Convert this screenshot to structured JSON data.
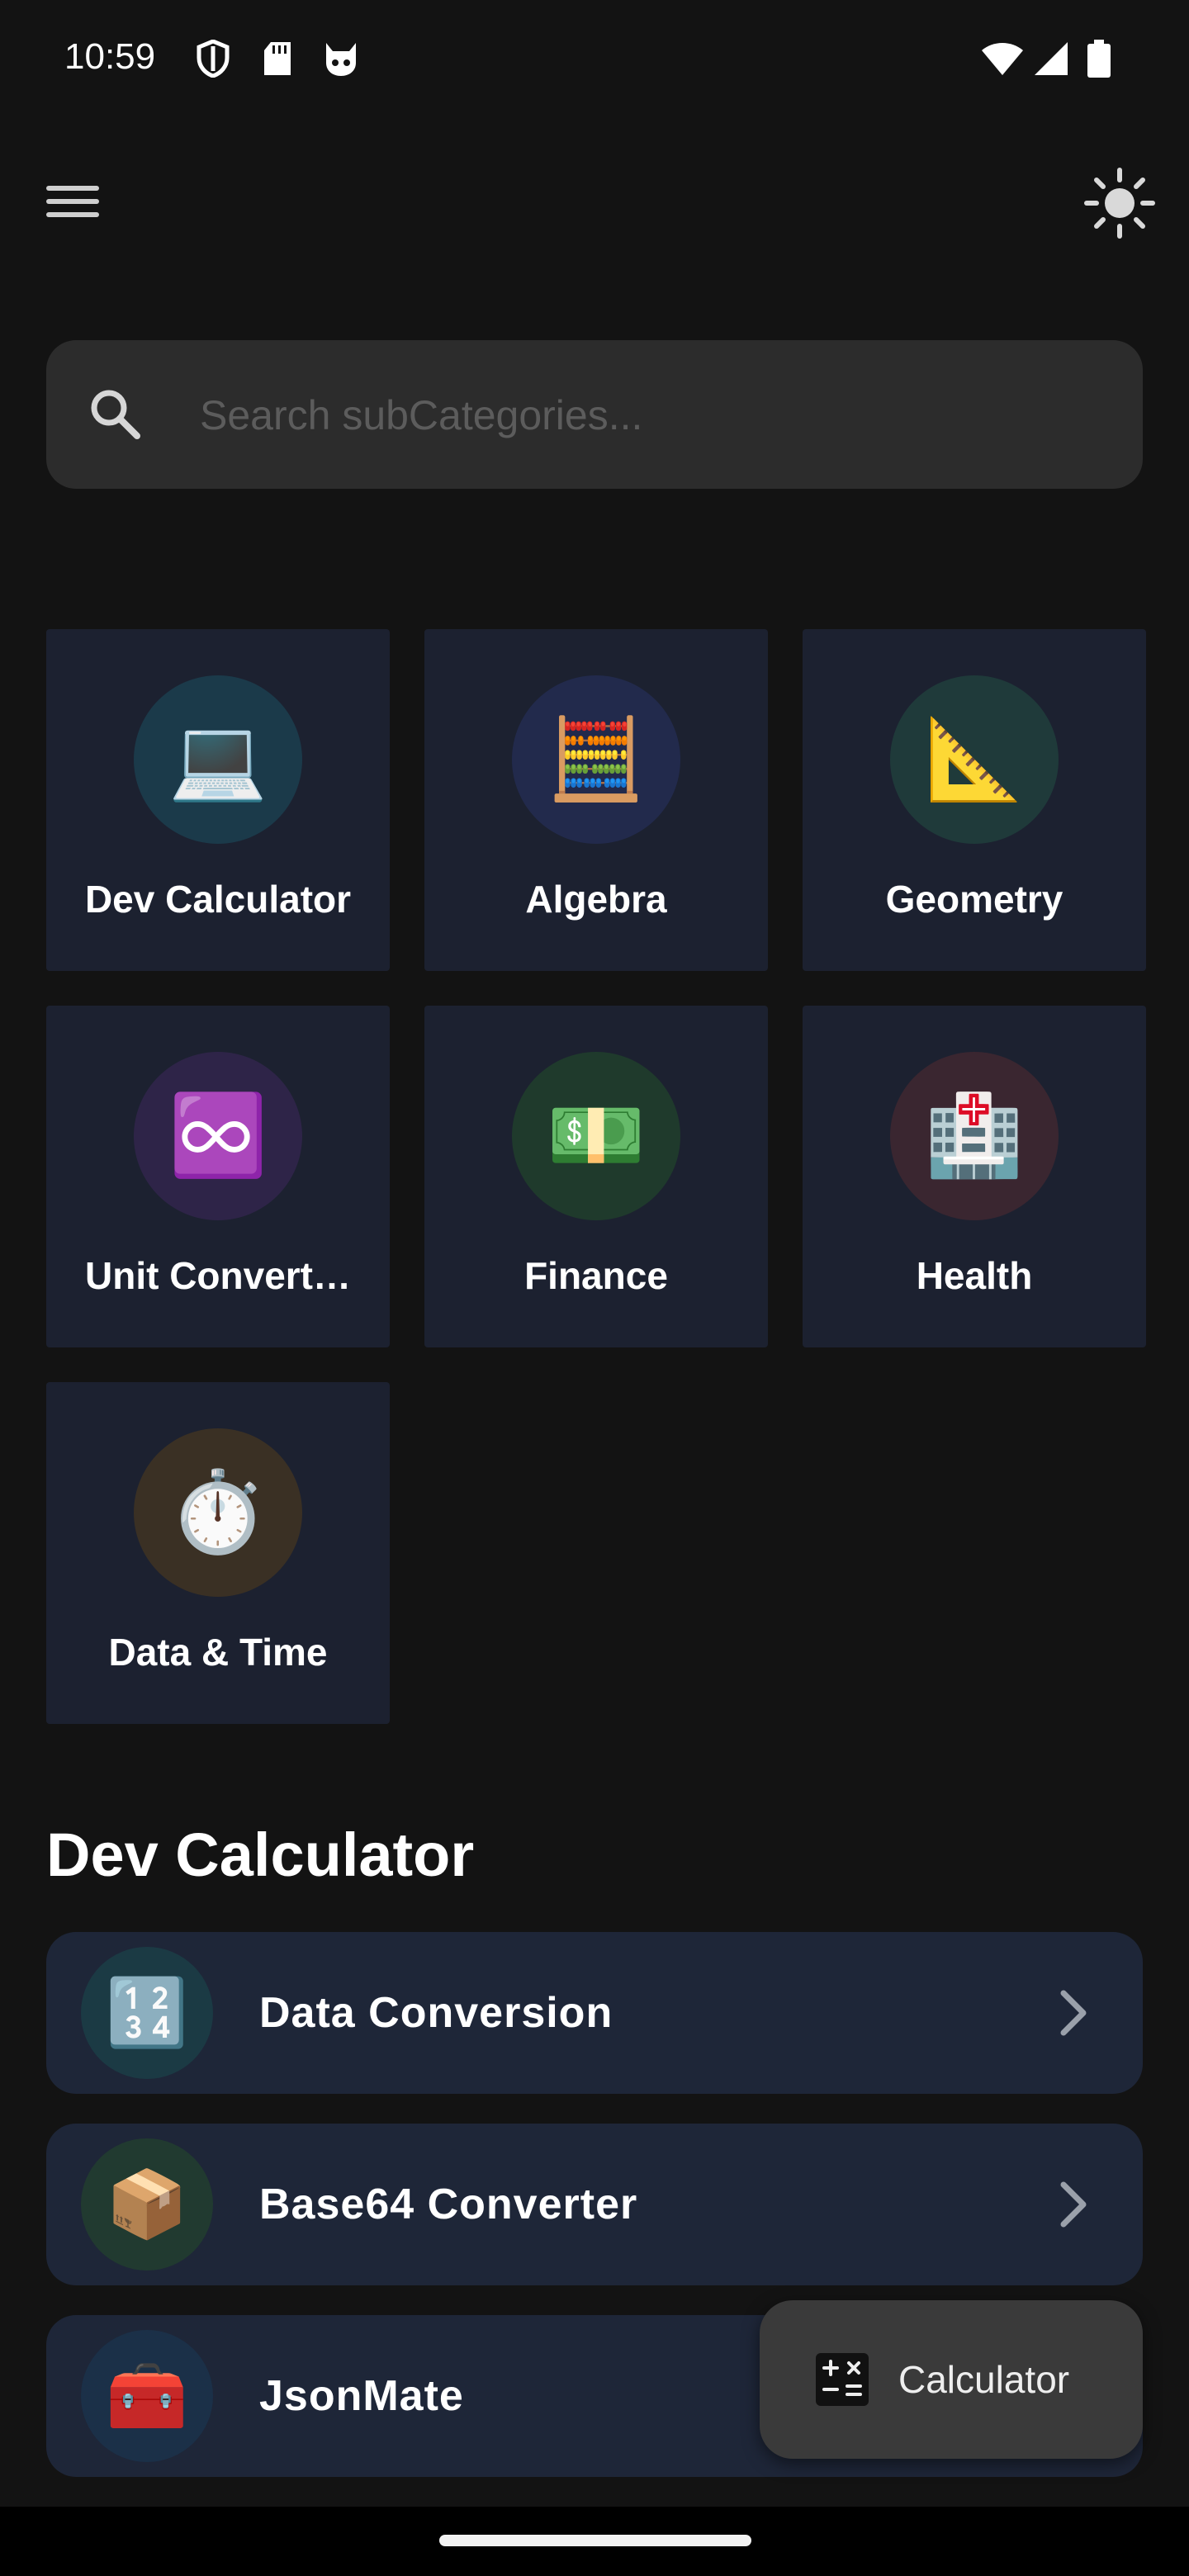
{
  "status_bar": {
    "time": "10:59",
    "left_icons": [
      "shield-icon",
      "sd-card-icon",
      "cat-face-icon"
    ],
    "right_icons": [
      "wifi-icon",
      "signal-icon",
      "battery-icon"
    ]
  },
  "app_bar": {
    "menu_icon": "menu-icon",
    "theme_icon": "sun-icon"
  },
  "search": {
    "placeholder": "Search subCategories...",
    "value": ""
  },
  "categories": [
    {
      "label": "Dev Calculator",
      "emoji": "💻",
      "circle_color": "#1b3a4a"
    },
    {
      "label": "Algebra",
      "emoji": "🧮",
      "circle_color": "#222a4c"
    },
    {
      "label": "Geometry",
      "emoji": "📐",
      "circle_color": "#1f3a3a"
    },
    {
      "label": "Unit Convert…",
      "emoji": "♾️",
      "circle_color": "#2e2448"
    },
    {
      "label": "Finance",
      "emoji": "💵",
      "circle_color": "#1f3a2c"
    },
    {
      "label": "Health",
      "emoji": "🏥",
      "circle_color": "#3a2630"
    },
    {
      "label": "Data & Time",
      "emoji": "⏱️",
      "circle_color": "#3a3024"
    }
  ],
  "section": {
    "title": "Dev Calculator",
    "items": [
      {
        "label": "Data Conversion",
        "emoji": "🔢",
        "circle_color": "#1b3a44"
      },
      {
        "label": "Base64 Converter",
        "emoji": "📦",
        "circle_color": "#213a30"
      },
      {
        "label": "JsonMate",
        "emoji": "🧰",
        "circle_color": "#1b3048"
      }
    ]
  },
  "fab": {
    "label": "Calculator",
    "icon": "calculator-icon"
  },
  "colors": {
    "background": "#131313",
    "tile": "#1c2130",
    "row": "#1e2638",
    "search": "#2c2c2c",
    "fab": "#3a3a3a"
  }
}
